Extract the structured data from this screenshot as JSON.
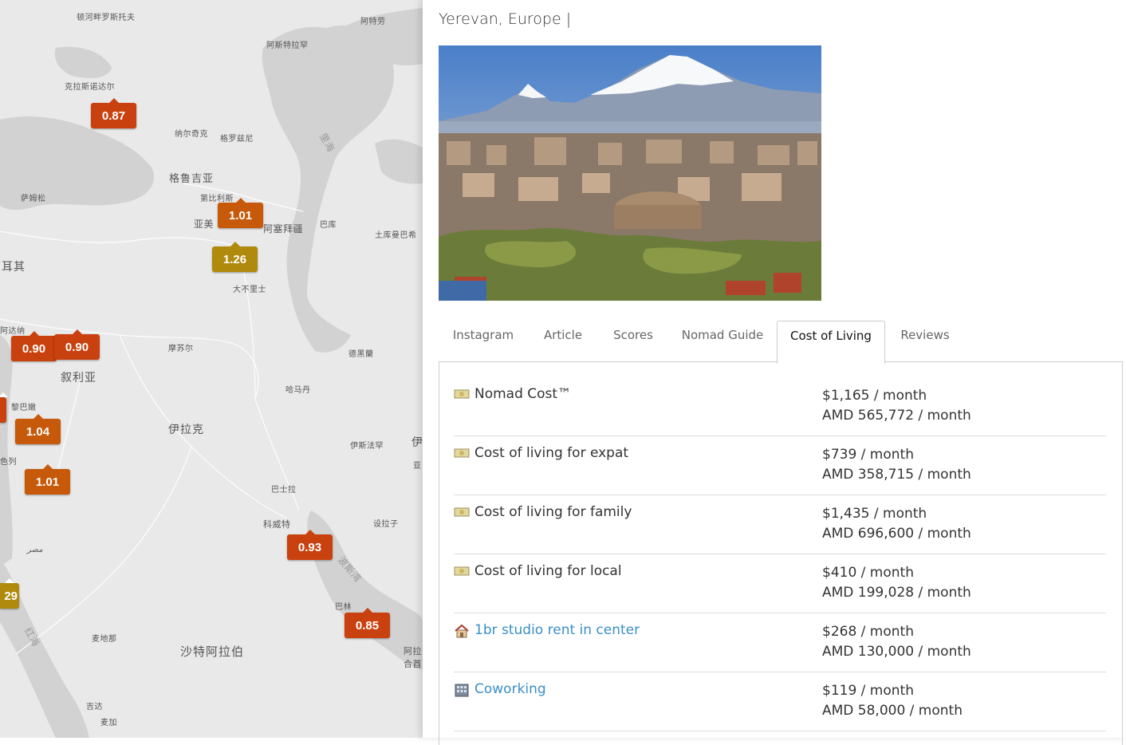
{
  "map": {
    "labels": {
      "l1": "顿河畔罗斯托夫",
      "l2": "阿特劳",
      "l3": "阿斯特拉罕",
      "l4": "克拉斯诺达尔",
      "l5": "纳尔奇克",
      "l6": "格罗兹尼",
      "l7": "格鲁吉亚",
      "l8": "第比利斯",
      "l9": "萨姆松",
      "l10": "亚美",
      "l11": "阿塞拜疆",
      "l12": "巴库",
      "l13": "土库曼巴希",
      "l14": "耳其",
      "l15": "大不里士",
      "l16": "阿达纳",
      "l17": "摩苏尔",
      "l18": "德黑蘭",
      "l19": "叙利亚",
      "l20": "哈马丹",
      "l21": "黎巴嫩",
      "l22": "伊拉克",
      "l23": "伊斯法罕",
      "l24": "色列",
      "l25": "巴士拉",
      "l26": "科威特",
      "l27": "设拉子",
      "l28": "伊",
      "l29": "亚",
      "l30": "巴林",
      "l31": "麦地那",
      "l32": "沙特阿拉伯",
      "l33": "阿拉",
      "l34": "合酋",
      "l35": "吉达",
      "l36": "麦加",
      "l37": "مصر",
      "sea1": "里海",
      "sea2": "波斯湾",
      "sea3": "红海"
    },
    "markers": [
      {
        "id": "m1",
        "value": "0.87",
        "color": "#c9410e"
      },
      {
        "id": "m2",
        "value": "1.01",
        "color": "#c65a0a"
      },
      {
        "id": "m3",
        "value": "1.26",
        "color": "#b08a0c"
      },
      {
        "id": "m4",
        "value": "0.90",
        "color": "#c9410e"
      },
      {
        "id": "m5",
        "value": "0.90",
        "color": "#c9410e"
      },
      {
        "id": "m6",
        "value": "1.04",
        "color": "#c65a0a"
      },
      {
        "id": "m7",
        "value": "1.01",
        "color": "#c65a0a"
      },
      {
        "id": "m8",
        "value": "0.93",
        "color": "#c9410e"
      },
      {
        "id": "m9",
        "value": "0.85",
        "color": "#c9410e"
      },
      {
        "id": "m10",
        "value": "29",
        "color": "#b08a0c"
      }
    ]
  },
  "panel": {
    "title": "Yerevan, Europe |",
    "tabs": [
      "Instagram",
      "Article",
      "Scores",
      "Nomad Guide",
      "Cost of Living",
      "Reviews"
    ],
    "active_tab": "Cost of Living",
    "rows": [
      {
        "icon": "money-icon",
        "label": "Nomad Cost™",
        "usd": "$1,165 / month",
        "amd": "AMD 565,772 / month",
        "link": false
      },
      {
        "icon": "money-icon",
        "label": "Cost of living for expat",
        "usd": "$739 / month",
        "amd": "AMD 358,715 / month",
        "link": false
      },
      {
        "icon": "money-icon",
        "label": "Cost of living for family",
        "usd": "$1,435 / month",
        "amd": "AMD 696,600 / month",
        "link": false
      },
      {
        "icon": "money-icon",
        "label": "Cost of living for local",
        "usd": "$410 / month",
        "amd": "AMD 199,028 / month",
        "link": false
      },
      {
        "icon": "house-icon",
        "label": "1br studio rent in center",
        "usd": "$268 / month",
        "amd": "AMD 130,000 / month",
        "link": true
      },
      {
        "icon": "office-building-icon",
        "label": "Coworking",
        "usd": "$119 / month",
        "amd": "AMD 58,000 / month",
        "link": true
      }
    ],
    "link_color": "#3a8fc7"
  }
}
